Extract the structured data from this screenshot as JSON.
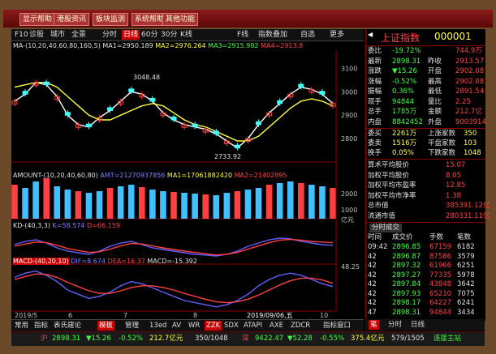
{
  "toolbar": {
    "b1": "显示帮助",
    "b2": "港股资讯",
    "b3": "板块监测",
    "b4": "系统帮助",
    "b5": "其他功能"
  },
  "tabs": {
    "t1": "F10",
    "t2": "诊股",
    "t3": "城市",
    "t4": "全景",
    "period_label": "分时",
    "period_selected": "日线",
    "p60": "60分",
    "p30": "30分",
    "kline": "K线",
    "ind1": "F线",
    "ind2": "指数叠加",
    "zoom": "自选",
    "more": "更多"
  },
  "ma_legend": {
    "name": "MA-(10,20,40,60,80,160,5)",
    "ma1": "MA1=2950.189",
    "ma2": "MA2=2976.264",
    "ma3": "MA3=2915.982",
    "ma4": "MA4=2913.8"
  },
  "main_axis": {
    "t1": "3100",
    "t2": "3000",
    "t3": "2900",
    "t4": "2800"
  },
  "price_labels": {
    "high": "3048.48",
    "low": "2733.92"
  },
  "amount_legend": {
    "name": "AMOUNT-(10,20,40,60,80)",
    "amt": "AMT=21270937856",
    "ma1": "MA1=17061882420",
    "ma2": "MA2=21402895"
  },
  "amount_axis": {
    "t1": "2000",
    "t2": "1000",
    "unit": "亿元"
  },
  "kd_legend": {
    "name": "KD-(40,3,3)",
    "k": "K=58.574",
    "d": "D=66.159"
  },
  "macd_legend": {
    "name": "MACD-(40,20,10)",
    "dif": "DIF=8.674",
    "dea": "DEA=16.37",
    "macd": "MACD=-15.392",
    "axis": "48.25"
  },
  "xaxis": {
    "d1": "2019/5",
    "d2": "6",
    "d3": "7",
    "d4": "8",
    "cursor_date": "2019/09/06,五",
    "d5": "10"
  },
  "index": {
    "name": "上证指数",
    "code": "000001"
  },
  "quote": [
    {
      "k": "委比",
      "v": "-19.72%",
      "k2": "",
      "v2": "744.9万"
    },
    {
      "k": "最新",
      "v": "2898.31",
      "k2": "昨收",
      "v2": "2913.57"
    },
    {
      "k": "涨跌",
      "v": "▼15.26",
      "k2": "开盘",
      "v2": "2902.08"
    },
    {
      "k": "涨幅",
      "v": "-0.52%",
      "k2": "最高",
      "v2": "2902.08"
    },
    {
      "k": "振幅",
      "v": "0.36%",
      "k2": "最低",
      "v2": "2891.54"
    },
    {
      "k": "现手",
      "v": "94844",
      "k2": "量比",
      "v2": "2.25"
    },
    {
      "k": "总手",
      "v": "1785万",
      "k2": "金额",
      "v2": "212.7亿"
    },
    {
      "k": "内盘",
      "v": "8842452",
      "k2": "外盘",
      "v2": "9003914"
    }
  ],
  "breadth": [
    {
      "k": "委买",
      "v": "2261万",
      "k2": "上涨家数",
      "v2": "350"
    },
    {
      "k": "委卖",
      "v": "1516万",
      "k2": "平盘家数",
      "v2": "103"
    },
    {
      "k": "换手",
      "v": "0.05%",
      "k2": "下跌家数",
      "v2": "1048"
    }
  ],
  "stats": [
    {
      "k": "算术平均股价",
      "v": "15.07"
    },
    {
      "k": "加权平均股价",
      "v": "8.05"
    },
    {
      "k": "加权平均市盈率",
      "v": "12.85"
    },
    {
      "k": "加权平均市净率",
      "v": "1.38"
    },
    {
      "k": "总市值",
      "v": "385391.12亿"
    },
    {
      "k": "流通市值",
      "v": "280331.11亿"
    }
  ],
  "ticks_header": {
    "tab": "分时成交",
    "c1": "时间",
    "c2": "成交价",
    "c3": "手数",
    "c4": "笔数"
  },
  "ticks": [
    {
      "t": "09:42",
      "p": "2896.85",
      "v": "67159",
      "n": "6182"
    },
    {
      "t": "42",
      "p": "2896.87",
      "v": "87586",
      "n": "3579"
    },
    {
      "t": "42",
      "p": "2897.32",
      "v": "61966",
      "n": "6251"
    },
    {
      "t": "42",
      "p": "2897.27",
      "v": "77335",
      "n": "5978"
    },
    {
      "t": "42",
      "p": "2897.84",
      "v": "43848",
      "n": "3642"
    },
    {
      "t": "42",
      "p": "2897.93",
      "v": "65210",
      "n": "7075"
    },
    {
      "t": "42",
      "p": "2898.17",
      "v": "64227",
      "n": "6241"
    },
    {
      "t": "47",
      "p": "2898.31",
      "v": "94844",
      "n": "3434"
    }
  ],
  "btmtabs": {
    "a": "常用",
    "b": "指标",
    "c": "表氏建论",
    "d": "模板",
    "e": "管理",
    "f": "13ed",
    "g": "AV",
    "h": "WR",
    "i": "ZZK",
    "j": "SDX",
    "k": "ATAPI",
    "l": "AXE",
    "m": "ZDCR",
    "n": "指标窗口"
  },
  "rptabs": {
    "a": "笔",
    "b": "分时",
    "c": "日线"
  },
  "status": {
    "a": "沪",
    "b": "2898.31",
    "c": "▼15.26",
    "d": "-0.52%",
    "e": "212.7亿元",
    "f": "350/1048",
    "g": "深",
    "h": "9422.47",
    "i": "▼52.28",
    "j": "-0.55%",
    "k": "375.4亿元",
    "l": "579/1505",
    "m": "连接主站"
  },
  "chart_data": [
    {
      "type": "line",
      "title": "",
      "series": [
        {
          "name": "MA1",
          "values": [
            2960,
            2990,
            3040,
            3030,
            2980,
            2900,
            2860,
            2850,
            2890,
            2920,
            2960,
            3000,
            2990,
            2960,
            2910,
            2880,
            2860,
            2850,
            2840,
            2820,
            2790,
            2760,
            2800,
            2860,
            2910,
            2950,
            2990,
            3020,
            3010,
            2990,
            2950
          ]
        },
        {
          "name": "MA2",
          "values": [
            3020,
            3030,
            3040,
            3040,
            3020,
            2980,
            2940,
            2900,
            2880,
            2880,
            2900,
            2920,
            2940,
            2950,
            2940,
            2910,
            2880,
            2860,
            2850,
            2830,
            2810,
            2790,
            2790,
            2810,
            2850,
            2890,
            2930,
            2960,
            2970,
            2960,
            2940
          ]
        }
      ],
      "ylim": [
        2700,
        3150
      ]
    },
    {
      "type": "bar",
      "title": "",
      "values": [
        2100,
        1900,
        2300,
        2500,
        2000,
        1800,
        1700,
        1600,
        1700,
        1900,
        2000,
        2100,
        1950,
        1800,
        1700,
        1650,
        1600,
        1550,
        1500,
        1450,
        1600,
        1700,
        1800,
        1900,
        2100,
        2200,
        2300,
        2200,
        2100,
        2000,
        1900
      ],
      "ylim": [
        0,
        2400
      ]
    },
    {
      "type": "line",
      "title": "",
      "series": [
        {
          "name": "K",
          "values": [
            60,
            70,
            75,
            65,
            50,
            40,
            35,
            30,
            40,
            55,
            65,
            70,
            60,
            50,
            45,
            40,
            35,
            30,
            28,
            25,
            30,
            40,
            55,
            65,
            75,
            80,
            78,
            70,
            65,
            60,
            58
          ]
        },
        {
          "name": "D",
          "values": [
            55,
            62,
            68,
            66,
            58,
            48,
            42,
            36,
            38,
            46,
            56,
            64,
            62,
            56,
            50,
            45,
            40,
            36,
            32,
            28,
            30,
            36,
            46,
            56,
            66,
            74,
            76,
            74,
            70,
            68,
            66
          ]
        }
      ],
      "ylim": [
        0,
        100
      ]
    },
    {
      "type": "line",
      "title": "",
      "series": [
        {
          "name": "DIF",
          "values": [
            30,
            40,
            45,
            35,
            20,
            0,
            -10,
            -20,
            -15,
            -5,
            10,
            20,
            15,
            5,
            -5,
            -15,
            -25,
            -30,
            -35,
            -40,
            -35,
            -25,
            -10,
            10,
            25,
            35,
            40,
            35,
            25,
            15,
            8
          ]
        },
        {
          "name": "DEA",
          "values": [
            25,
            32,
            38,
            37,
            30,
            18,
            8,
            -2,
            -8,
            -8,
            -2,
            6,
            10,
            10,
            6,
            0,
            -8,
            -15,
            -22,
            -28,
            -30,
            -28,
            -22,
            -12,
            0,
            12,
            22,
            28,
            28,
            24,
            16
          ]
        }
      ],
      "ylim": [
        -50,
        50
      ]
    }
  ]
}
